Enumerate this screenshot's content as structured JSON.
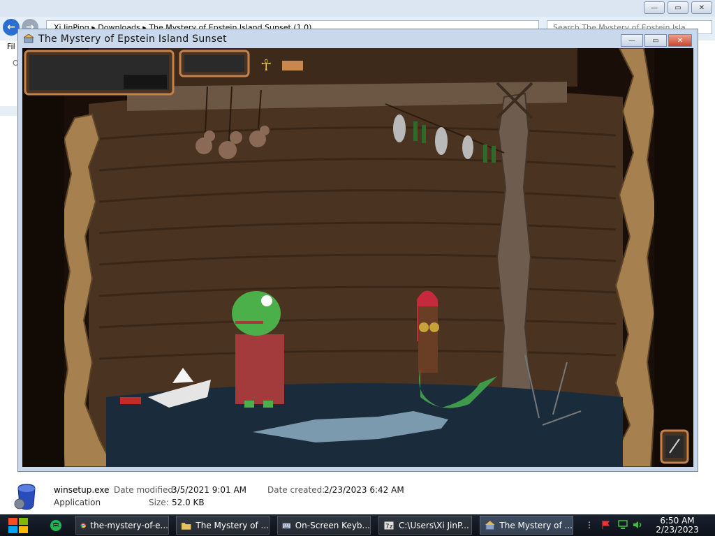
{
  "explorer": {
    "breadcrumb": [
      "Xi JinPing",
      "Downloads",
      "The Mystery of Epstein Island Sunset (1.0)"
    ],
    "search_placeholder": "Search The Mystery of Epstein Isla...",
    "menu_stub": "Fil"
  },
  "game_window": {
    "title": "The Mystery of Epstein Island Sunset",
    "buttons": {
      "minimize": "—",
      "maximize": "▭",
      "close": "✕"
    }
  },
  "details": {
    "file_name": "winsetup.exe",
    "file_type": "Application",
    "date_modified_label": "Date modified:",
    "date_modified": "3/5/2021 9:01 AM",
    "date_created_label": "Date created:",
    "date_created": "2/23/2023 6:42 AM",
    "size_label": "Size:",
    "size": "52.0 KB"
  },
  "taskbar": {
    "items": [
      {
        "label": "the-mystery-of-e...",
        "icon": "chrome-icon"
      },
      {
        "label": "The Mystery of ...",
        "icon": "folder-icon"
      },
      {
        "label": "On-Screen Keyb...",
        "icon": "keyboard-icon"
      },
      {
        "label": "C:\\Users\\Xi JinP...",
        "icon": "archive-icon"
      },
      {
        "label": "The Mystery of ...",
        "icon": "game-window-icon"
      }
    ],
    "clock_time": "6:50 AM",
    "clock_date": "2/23/2023"
  },
  "colors": {
    "window_frame": "#c9d8ea",
    "taskbar": "#141a24",
    "close_red": "#c9452c",
    "scene_wood": "#4a3321",
    "scene_water": "#1a2c3c"
  }
}
